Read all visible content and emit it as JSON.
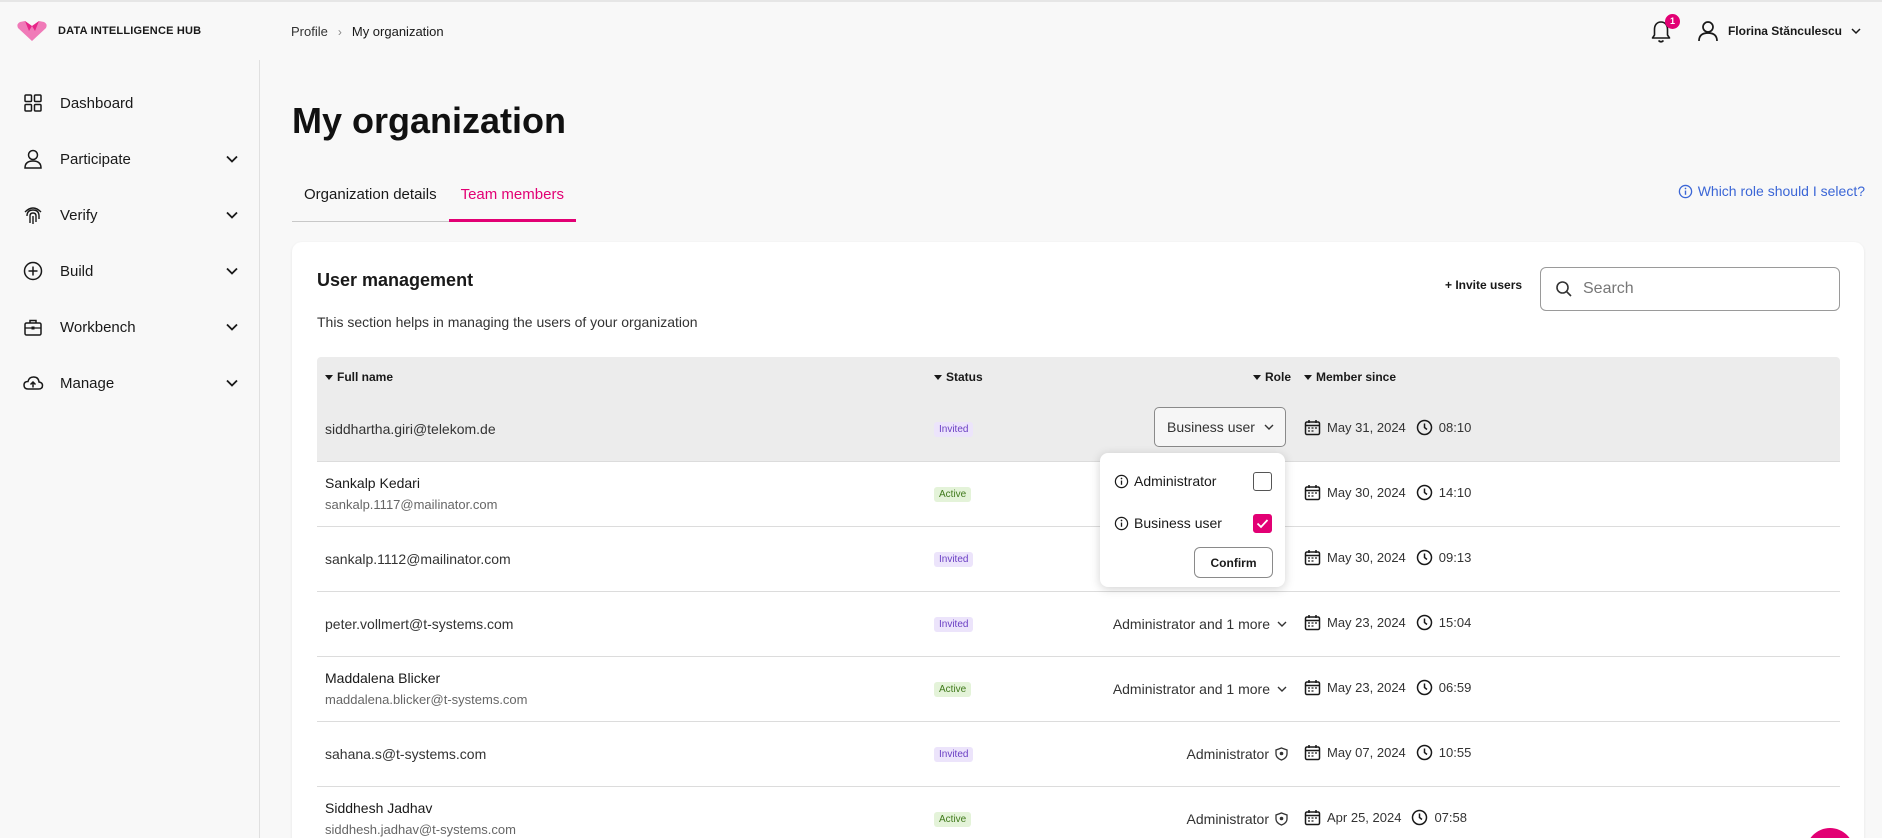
{
  "brand": {
    "name": "DATA INTELLIGENCE HUB",
    "accent": "#e20074"
  },
  "breadcrumb": [
    {
      "label": "Profile"
    },
    {
      "label": "My organization"
    }
  ],
  "breadcrumb_separator": "›",
  "header": {
    "notification_count": "1",
    "user_name": "Florina Stănculescu"
  },
  "sidebar": {
    "items": [
      {
        "label": "Dashboard",
        "icon": "grid-icon",
        "expandable": false
      },
      {
        "label": "Participate",
        "icon": "person-icon",
        "expandable": true
      },
      {
        "label": "Verify",
        "icon": "fingerprint-icon",
        "expandable": true
      },
      {
        "label": "Build",
        "icon": "plus-circle-icon",
        "expandable": true
      },
      {
        "label": "Workbench",
        "icon": "briefcase-icon",
        "expandable": true
      },
      {
        "label": "Manage",
        "icon": "cloud-upload-icon",
        "expandable": true
      }
    ]
  },
  "page": {
    "title": "My organization",
    "tabs": [
      {
        "label": "Organization details",
        "active": false
      },
      {
        "label": "Team members",
        "active": true
      }
    ],
    "role_help": "Which role should I select?"
  },
  "user_management": {
    "title": "User management",
    "description": "This section helps in managing the users of your organization",
    "invite_label": "+ Invite users",
    "search_placeholder": "Search",
    "columns": {
      "name": "Full name",
      "status": "Status",
      "role": "Role",
      "member_since": "Member since"
    },
    "rows": [
      {
        "name": "siddhartha.giri@telekom.de",
        "email": "",
        "status": "Invited",
        "role": "Business user",
        "role_mode": "select",
        "date": "May 31, 2024",
        "time": "08:10"
      },
      {
        "name": "Sankalp Kedari",
        "email": "sankalp.1117@mailinator.com",
        "status": "Active",
        "role": "",
        "role_mode": "hidden",
        "date": "May 30, 2024",
        "time": "14:10"
      },
      {
        "name": "sankalp.1112@mailinator.com",
        "email": "",
        "status": "Invited",
        "role": "",
        "role_mode": "hidden",
        "date": "May 30, 2024",
        "time": "09:13"
      },
      {
        "name": "peter.vollmert@t-systems.com",
        "email": "",
        "status": "Invited",
        "role": "Administrator and 1 more",
        "role_mode": "dropdown",
        "date": "May 23, 2024",
        "time": "15:04"
      },
      {
        "name": "Maddalena Blicker",
        "email": "maddalena.blicker@t-systems.com",
        "status": "Active",
        "role": "Administrator and 1 more",
        "role_mode": "dropdown",
        "date": "May 23, 2024",
        "time": "06:59"
      },
      {
        "name": "sahana.s@t-systems.com",
        "email": "",
        "status": "Invited",
        "role": "Administrator",
        "role_mode": "shield",
        "date": "May 07, 2024",
        "time": "10:55"
      },
      {
        "name": "Siddhesh Jadhav",
        "email": "siddhesh.jadhav@t-systems.com",
        "status": "Active",
        "role": "Administrator",
        "role_mode": "shield",
        "date": "Apr 25, 2024",
        "time": "07:58"
      }
    ]
  },
  "role_popover": {
    "options": [
      {
        "label": "Administrator",
        "checked": false
      },
      {
        "label": "Business user",
        "checked": true
      }
    ],
    "confirm_label": "Confirm"
  }
}
